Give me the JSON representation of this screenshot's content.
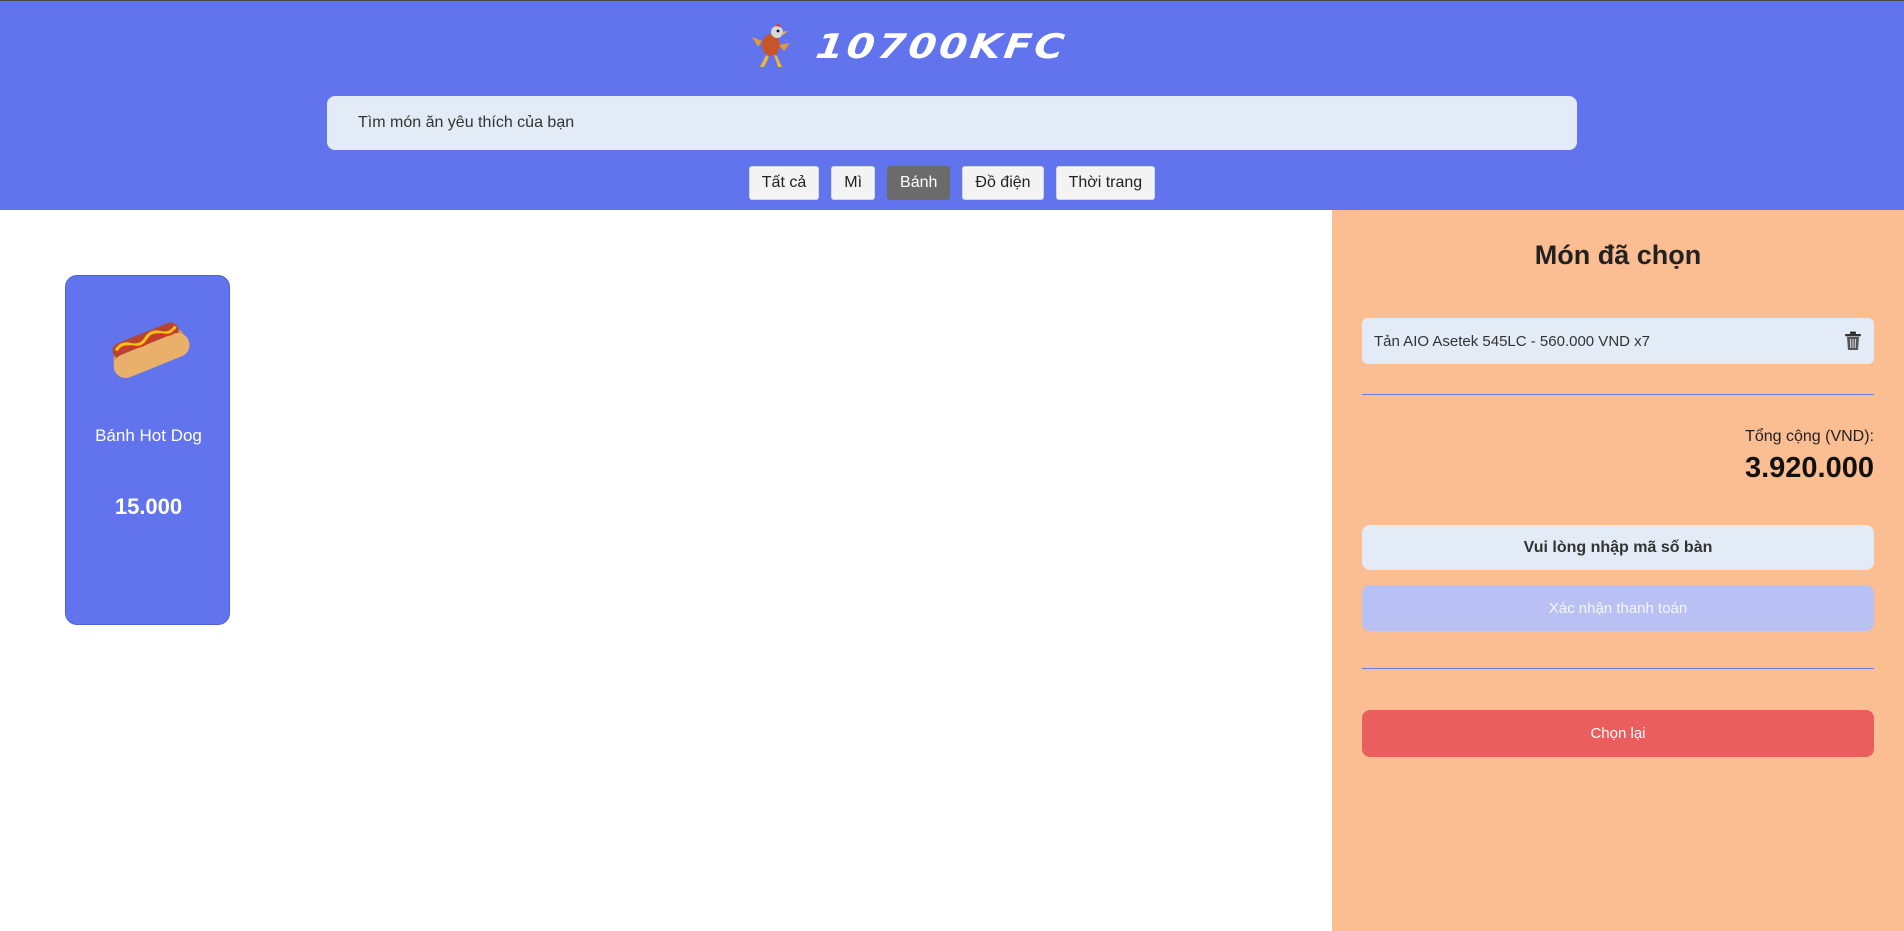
{
  "header": {
    "logo_text": "10700KFC",
    "search_placeholder": "Tìm món ăn yêu thích của bạn",
    "categories": [
      {
        "label": "Tất cả",
        "active": false
      },
      {
        "label": "Mì",
        "active": false
      },
      {
        "label": "Bánh",
        "active": true
      },
      {
        "label": "Đồ điện",
        "active": false
      },
      {
        "label": "Thời trang",
        "active": false
      }
    ]
  },
  "products": [
    {
      "name": "Bánh Hot Dog",
      "price": "15.000",
      "icon": "hot-dog-icon"
    }
  ],
  "cart": {
    "title": "Món đã chọn",
    "items": [
      {
        "text": "Tản AIO Asetek 545LC - 560.000 VND x7",
        "icon": "trash-icon"
      }
    ],
    "total_label": "Tổng cộng (VND):",
    "total_value": "3.920.000",
    "table_placeholder": "Vui lòng nhập mã số bàn",
    "confirm_label": "Xác nhận thanh toán",
    "reset_label": "Chọn lại"
  },
  "colors": {
    "header_bg": "#6174ee",
    "cart_bg": "#fbbe93",
    "active_category": "#6b6b6b",
    "confirm_disabled": "#b9c0f4",
    "reset": "#ea5f5e"
  }
}
